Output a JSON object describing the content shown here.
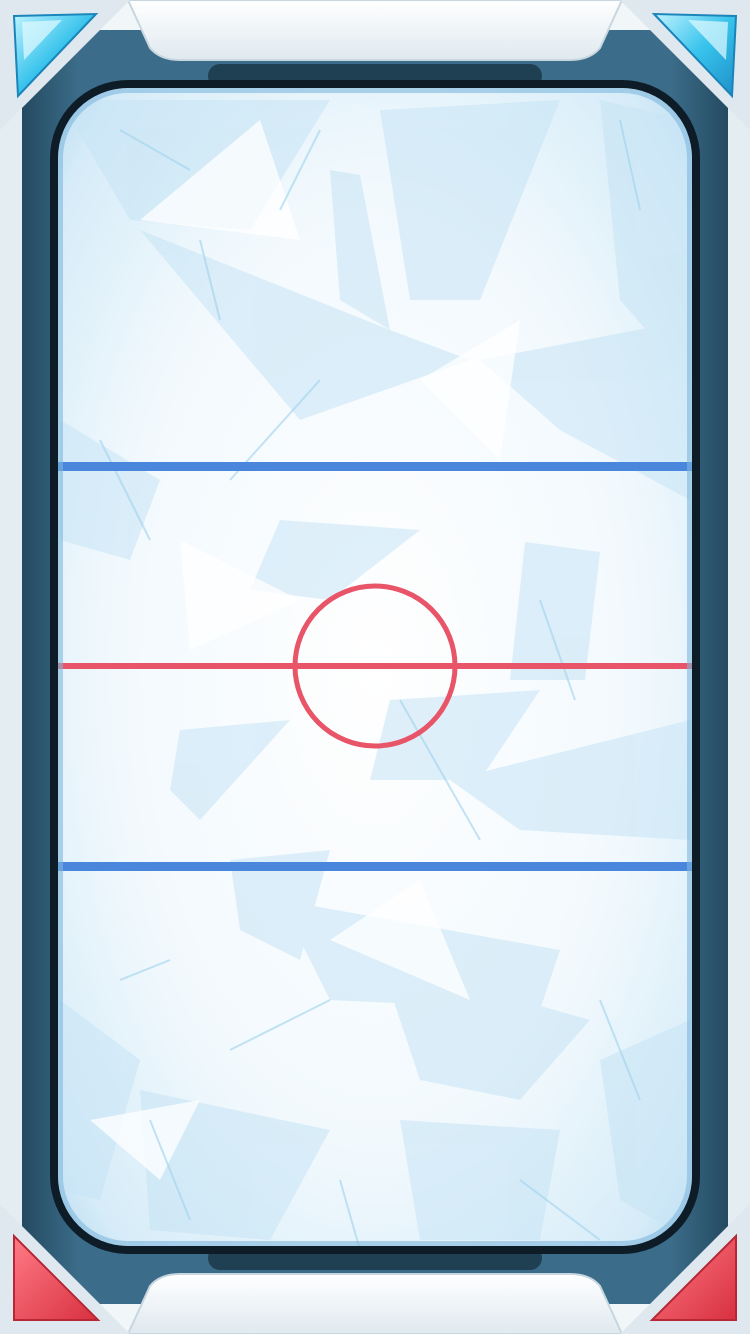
{
  "game": {
    "name": "",
    "score_top": "",
    "score_bottom": ""
  },
  "colors": {
    "frame_dark": "#2e5b75",
    "frame_mid": "#3f7391",
    "frame_light": "#f4f8fb",
    "ice": "#eaf6fd",
    "ice_shard": "#cfe9f7",
    "blue_line": "#4a86dc",
    "red_line": "#e85468",
    "corner_top": "#2fb9e6",
    "corner_bottom": "#e43d4c"
  },
  "icons": {
    "top_left": "cyan-gem-corner",
    "top_right": "cyan-gem-corner",
    "bottom_left": "red-triangle-corner",
    "bottom_right": "red-triangle-corner"
  }
}
